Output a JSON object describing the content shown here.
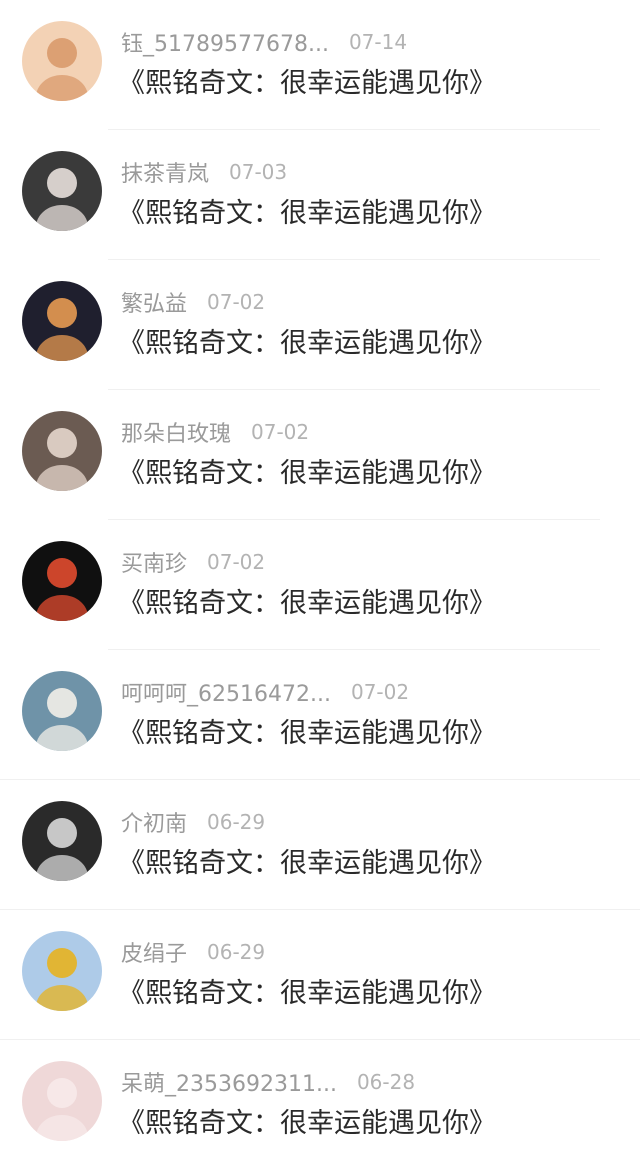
{
  "comments": [
    {
      "avatar": "cartoon-boy-avatar",
      "name": "钰_51789577678...",
      "date": "07-14",
      "title": "《熙铭奇文：很幸运能遇见你》",
      "bg": "#f3d2b5",
      "fg": "#d99a6c"
    },
    {
      "avatar": "girl-dark-outfit-avatar",
      "name": "抹茶青岚",
      "date": "07-03",
      "title": "《熙铭奇文：很幸运能遇见你》",
      "bg": "#3a3a3a",
      "fg": "#e8e0dc"
    },
    {
      "avatar": "glowing-hands-avatar",
      "name": "繁弘益",
      "date": "07-02",
      "title": "《熙铭奇文：很幸运能遇见你》",
      "bg": "#1f1f2e",
      "fg": "#e79a52"
    },
    {
      "avatar": "two-girls-vintage-avatar",
      "name": "那朵白玫瑰",
      "date": "07-02",
      "title": "《熙铭奇文：很幸运能遇见你》",
      "bg": "#6b5b52",
      "fg": "#e6d6cc"
    },
    {
      "avatar": "red-flower-fruit-avatar",
      "name": "买南珍",
      "date": "07-02",
      "title": "《熙铭奇文：很幸运能遇见你》",
      "bg": "#101010",
      "fg": "#e14b2f"
    },
    {
      "avatar": "girl-at-sea-avatar",
      "name": "呵呵呵_62516472...",
      "date": "07-02",
      "title": "《熙铭奇文：很幸运能遇见你》",
      "bg": "#6f93a8",
      "fg": "#f2efe8"
    },
    {
      "avatar": "bw-portrait-avatar",
      "name": "介初南",
      "date": "06-29",
      "title": "《熙铭奇文：很幸运能遇见你》",
      "bg": "#2a2a2a",
      "fg": "#d8d8d8"
    },
    {
      "avatar": "flower-field-girl-avatar",
      "name": "皮绢子",
      "date": "06-29",
      "title": "《熙铭奇文：很幸运能遇见你》",
      "bg": "#aecbe8",
      "fg": "#e7b320"
    },
    {
      "avatar": "pink-hair-girl-avatar",
      "name": "呆萌_2353692311...",
      "date": "06-28",
      "title": "《熙铭奇文：很幸运能遇见你》",
      "bg": "#efd8d8",
      "fg": "#f7eaea"
    }
  ]
}
